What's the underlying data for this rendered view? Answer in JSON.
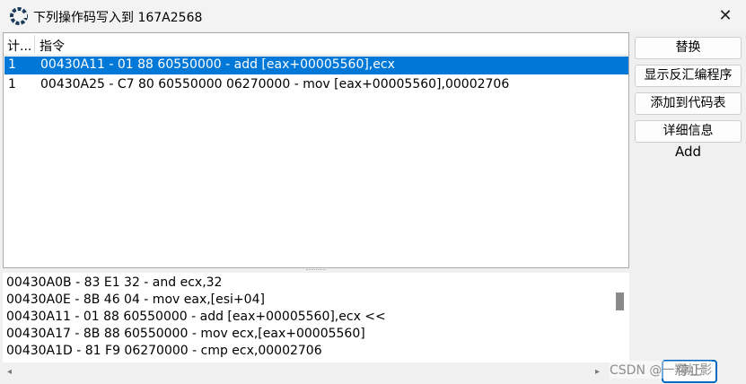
{
  "window": {
    "title": "下列操作码写入到 167A2568",
    "close_symbol": "✕",
    "app_icon": "cheat-engine-icon"
  },
  "list": {
    "headers": {
      "count": "计...",
      "instruction": "指令"
    },
    "rows": [
      {
        "count": "1",
        "instruction": "00430A11 - 01 88 60550000  - add [eax+00005560],ecx",
        "selected": true
      },
      {
        "count": "1",
        "instruction": "00430A25 - C7 80 60550000 06270000 - mov [eax+00005560],00002706",
        "selected": false
      }
    ]
  },
  "side_buttons": {
    "replace": "替换",
    "show_disassembler": "显示反汇编程序",
    "add_to_codelist": "添加到代码表",
    "details": "详细信息"
  },
  "side_label": "Add",
  "disassembly": [
    "00430A0B - 83 E1 32 - and ecx,32",
    "00430A0E - 8B 46 04  - mov eax,[esi+04]",
    "00430A11 - 01 88 60550000  - add [eax+00005560],ecx <<",
    "00430A17 - 8B 88 60550000  - mov ecx,[eax+00005560]",
    "00430A1D - 81 F9 06270000 - cmp ecx,00002706"
  ],
  "stop_button": "停止",
  "watermark": "CSDN @一翔灯影",
  "colors": {
    "selection": "#0078d7",
    "ok_border": "#0067c0"
  }
}
